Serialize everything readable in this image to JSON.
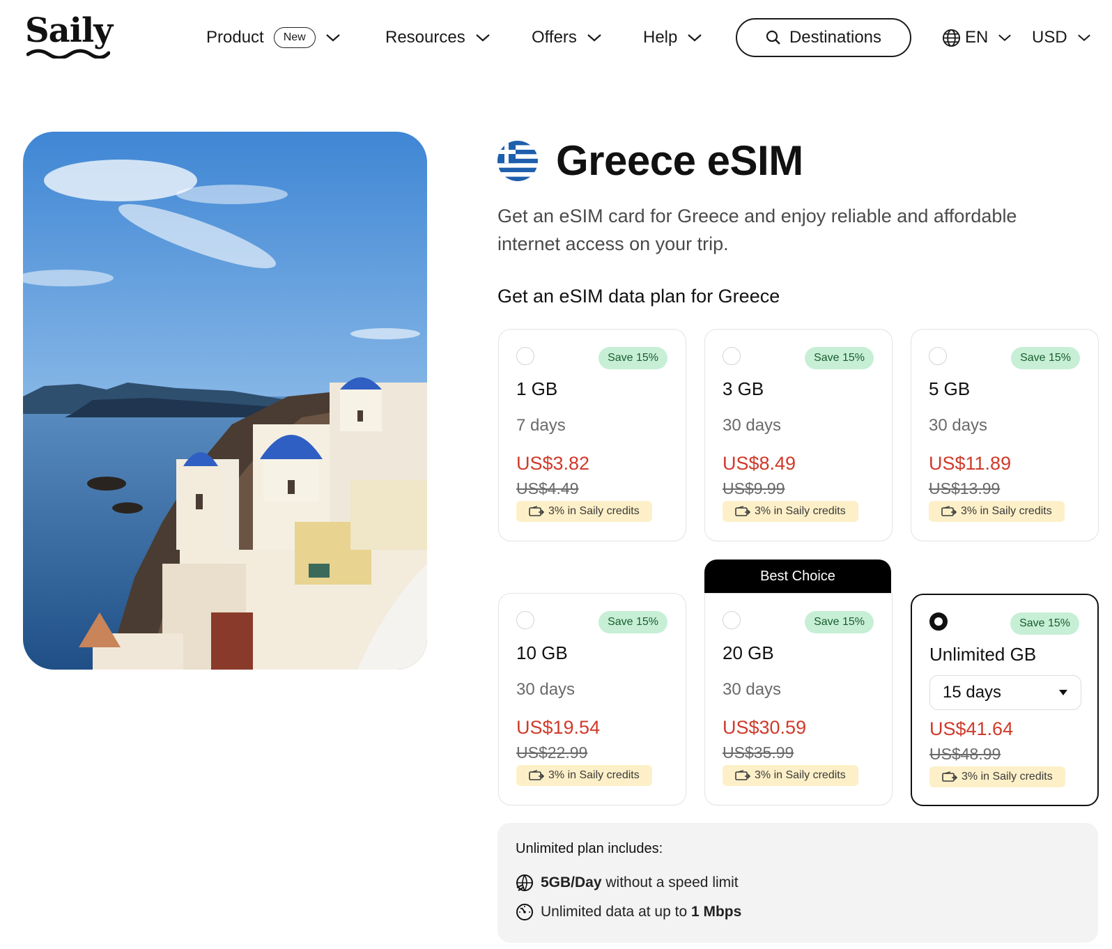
{
  "header": {
    "logo": "Saily",
    "nav": [
      {
        "label": "Product",
        "badge": "New"
      },
      {
        "label": "Resources"
      },
      {
        "label": "Offers"
      },
      {
        "label": "Help"
      }
    ],
    "destinations_label": "Destinations",
    "language": "EN",
    "currency": "USD"
  },
  "hero_image": {
    "icon": "santorini-photo"
  },
  "page": {
    "flag_icon": "greece-flag-icon",
    "title": "Greece eSIM",
    "subtitle": "Get an eSIM card for Greece and enjoy reliable and affordable internet access on your trip.",
    "section_title": "Get an eSIM data plan for Greece"
  },
  "plans": [
    {
      "data": "1 GB",
      "days": "7 days",
      "save": "Save 15%",
      "price": "US$3.82",
      "old_price": "US$4.49",
      "credits": "3% in Saily credits",
      "selected": false
    },
    {
      "data": "3 GB",
      "days": "30 days",
      "save": "Save 15%",
      "price": "US$8.49",
      "old_price": "US$9.99",
      "credits": "3% in Saily credits",
      "selected": false
    },
    {
      "data": "5 GB",
      "days": "30 days",
      "save": "Save 15%",
      "price": "US$11.89",
      "old_price": "US$13.99",
      "credits": "3% in Saily credits",
      "selected": false
    },
    {
      "data": "10 GB",
      "days": "30 days",
      "save": "Save 15%",
      "price": "US$19.54",
      "old_price": "US$22.99",
      "credits": "3% in Saily credits",
      "selected": false
    },
    {
      "data": "20 GB",
      "days": "30 days",
      "save": "Save 15%",
      "price": "US$30.59",
      "old_price": "US$35.99",
      "credits": "3% in Saily credits",
      "selected": false,
      "ribbon": "Best Choice"
    },
    {
      "data": "Unlimited GB",
      "days_select": "15 days",
      "save": "Save 15%",
      "price": "US$41.64",
      "old_price": "US$48.99",
      "credits": "3% in Saily credits",
      "selected": true
    }
  ],
  "unlimited_info": {
    "title": "Unlimited plan includes:",
    "row1_bold": "5GB/Day",
    "row1_text": " without a speed limit",
    "row2_text": "Unlimited data at up to ",
    "row2_bold": "1 Mbps"
  },
  "colors": {
    "price_red": "#d03a2a",
    "save_green_bg": "#c6efd5",
    "credits_bg": "#fdf0c8",
    "info_bg": "#f3f3f3",
    "ribbon_bg": "#000000"
  }
}
